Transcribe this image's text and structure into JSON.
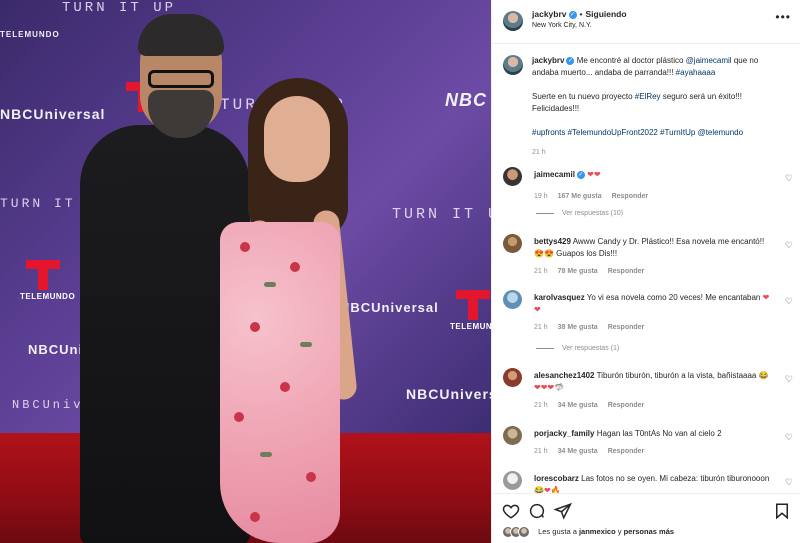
{
  "photo": {
    "wall_texts": [
      "TURN IT UP",
      "TELEMUNDO",
      "NBCUniversal",
      "NBC",
      "TURN IT UP",
      "NBCUniversal",
      "TELEMUNDO",
      "TURN IT UP",
      "NBCUniversal",
      "TURN IT UP",
      "NBCUniversal",
      "TELEMUNDO"
    ],
    "colors": {
      "backdrop": "#5a3e92",
      "carpet": "#b0121a",
      "telemundo_red": "#e3162d"
    }
  },
  "header": {
    "username": "jackybrv",
    "separator": "•",
    "follow_status": "Siguiendo",
    "location": "New York City, N.Y.",
    "more_icon": "more-horizontal-icon"
  },
  "caption": {
    "username": "jackybrv",
    "line1_text": "Me encontré al doctor plástico",
    "mention1": "@jaimecamil",
    "line1_rest": "que no andaba muerto... andaba de parranda!!!",
    "hashtag1": "#ayahaaaa",
    "para2_text": "Suerte en tu nuevo proyecto",
    "hashtag2": "#ElRey",
    "para2_rest": "seguro será un éxito!!! Felicidades!!!",
    "hashtags": "#upfronts #TelemundoUpFront2022 #TurnItUp @telemundo",
    "time": "21 h"
  },
  "comments": [
    {
      "username": "jaimecamil",
      "verified": true,
      "text": "",
      "emoji": "❤❤",
      "time": "19 h",
      "likes": "167 Me gusta",
      "reply": "Responder",
      "replies": "Ver respuestas (10)"
    },
    {
      "username": "bettys429",
      "verified": false,
      "text": "Awww Candy y Dr. Plástico!! Esa novela me encantó!!",
      "emoji": "😍😍",
      "text2": "Guapos los Dis!!!",
      "time": "21 h",
      "likes": "78 Me gusta",
      "reply": "Responder"
    },
    {
      "username": "karolvasquez",
      "verified": false,
      "text": "Yo vi esa novela como 20 veces! Me encantaban",
      "emoji": "❤❤",
      "time": "21 h",
      "likes": "38 Me gusta",
      "reply": "Responder",
      "replies": "Ver respuestas (1)"
    },
    {
      "username": "alesanchez1402",
      "verified": false,
      "text": "Tiburón tiburón, tiburón a la vista, bañistaaaa",
      "emoji": "😂❤❤❤🦈",
      "time": "21 h",
      "likes": "34 Me gusta",
      "reply": "Responder"
    },
    {
      "username": "porjacky_family",
      "verified": false,
      "text": "Hagan las T0ntAs No van al cielo 2",
      "time": "21 h",
      "likes": "34 Me gusta",
      "reply": "Responder"
    },
    {
      "username": "lorescobarz",
      "verified": false,
      "text": "Las fotos no se oyen. Mi cabeza: tiburón tiburonooon",
      "emoji": "😂❤🔥"
    }
  ],
  "actions": {
    "likes_prefix": "Les gusta a",
    "likes_user": "janmexico",
    "likes_suffix": "y",
    "likes_more": "personas más"
  }
}
